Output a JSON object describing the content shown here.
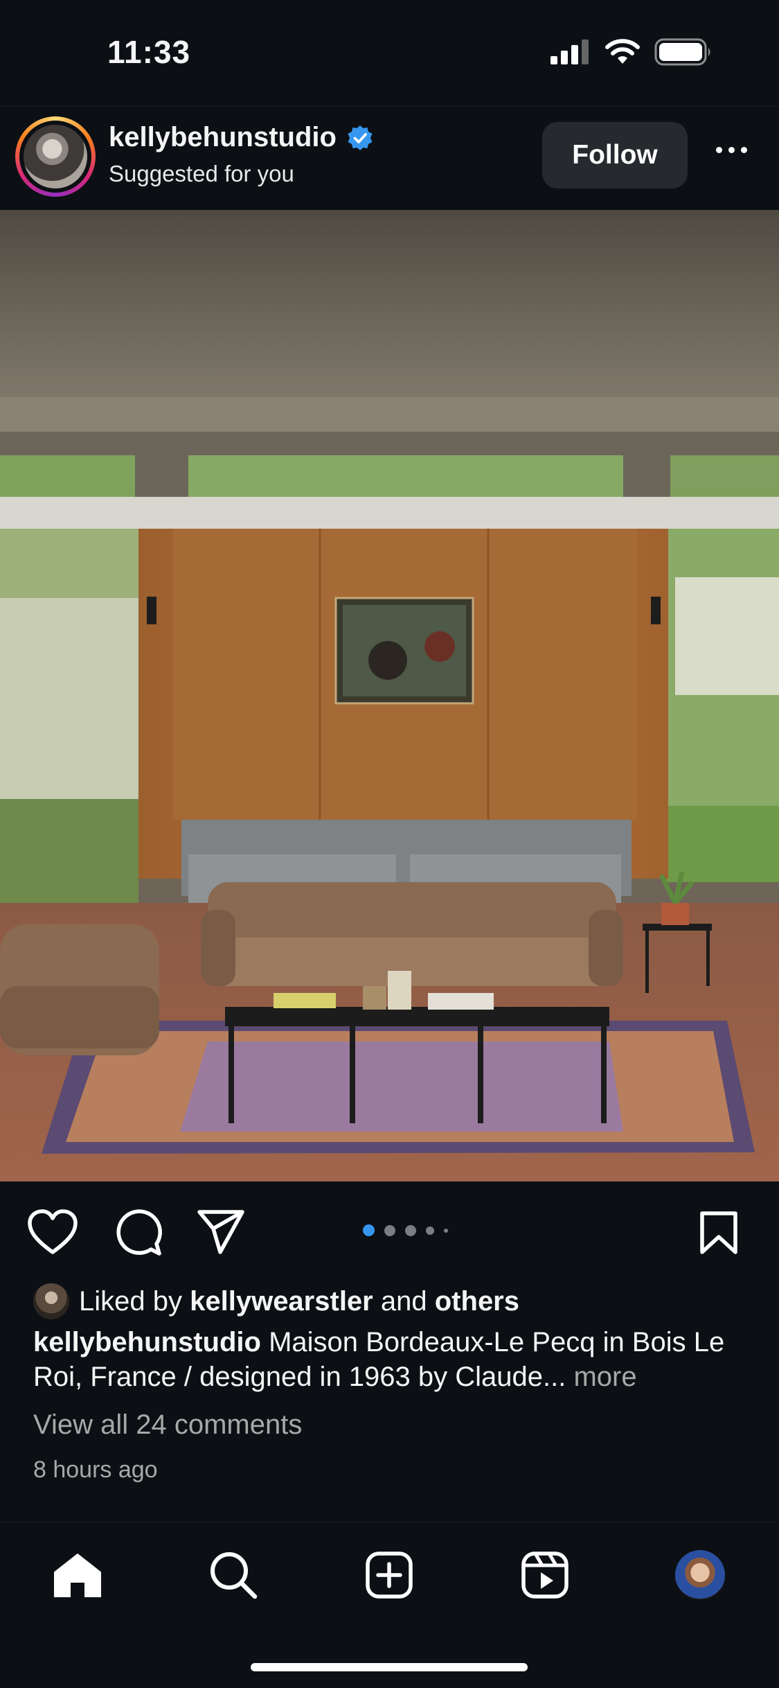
{
  "status_bar": {
    "time": "11:33",
    "icons": [
      "cellular-signal-icon",
      "wifi-icon",
      "battery-icon"
    ]
  },
  "post": {
    "username": "kellybehunstudio",
    "verified": true,
    "subtitle": "Suggested for you",
    "follow_label": "Follow",
    "carousel": {
      "current": 1,
      "total": 5
    },
    "liked_by_prefix": "Liked by",
    "liked_by_user": "kellywearstler",
    "liked_by_join": "and",
    "liked_by_others": "others",
    "caption_user": "kellybehunstudio",
    "caption_text": "Maison Bordeaux-Le Pecq in Bois Le Roi, France / designed in 1963 by Claude...",
    "caption_more": "more",
    "view_comments": "View all 24 comments",
    "timestamp": "8 hours ago"
  },
  "tab_bar": {
    "items": [
      "home-icon",
      "search-icon",
      "create-post-icon",
      "reels-icon",
      "profile-avatar"
    ],
    "active": "home-icon"
  },
  "colors": {
    "background": "#0c1014",
    "verified_badge": "#3797f0",
    "active_dot": "#3797f0",
    "secondary_text": "#a8a8a8",
    "follow_button": "#262a2f"
  }
}
